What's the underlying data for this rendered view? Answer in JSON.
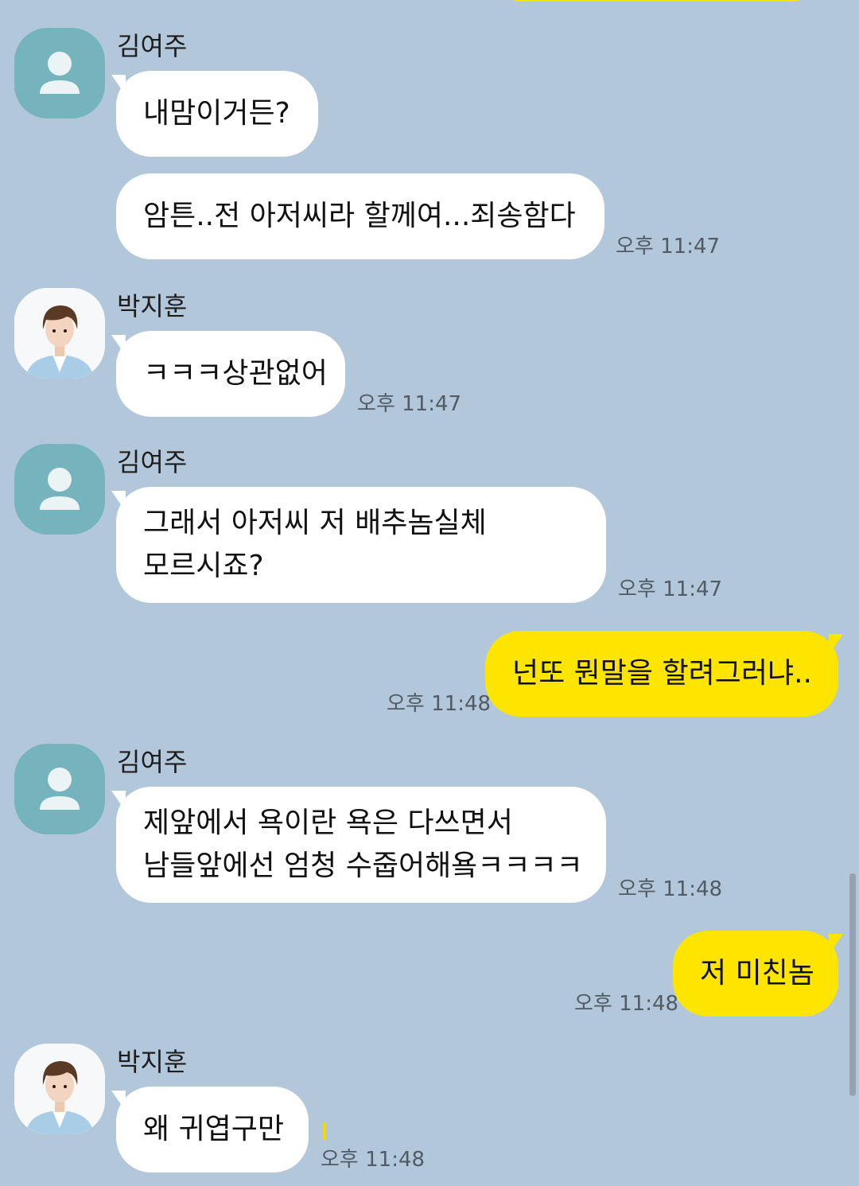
{
  "conversation": {
    "messages": [
      {
        "sender": "김여주",
        "direction": "incoming",
        "text": "내맘이거든?",
        "time": ""
      },
      {
        "sender": "김여주",
        "direction": "incoming",
        "text": "암튼..전 아저씨라 할께여...죄송함다",
        "time": "오후 11:47"
      },
      {
        "sender": "박지훈",
        "direction": "incoming",
        "text": "ㅋㅋㅋ상관없어",
        "time": "오후 11:47"
      },
      {
        "sender": "김여주",
        "direction": "incoming",
        "lines": [
          "그래서 아저씨 저 배추놈실체",
          "모르시죠?"
        ],
        "time": "오후 11:47"
      },
      {
        "sender": "",
        "direction": "outgoing",
        "text": "넌또 뭔말을 할려그러냐..",
        "time": "오후 11:48"
      },
      {
        "sender": "김여주",
        "direction": "incoming",
        "lines": [
          "제앞에서 욕이란 욕은 다쓰면서",
          "남들앞에선 엄청 수줍어해욬ㅋㅋㅋㅋ"
        ],
        "time": "오후 11:48"
      },
      {
        "sender": "",
        "direction": "outgoing",
        "text": "저 미친놈",
        "time": "오후 11:48"
      },
      {
        "sender": "박지훈",
        "direction": "incoming",
        "text": "왜 귀엽구만",
        "time": "오후 11:48"
      }
    ]
  },
  "colors": {
    "background": "#b2c7da",
    "incoming_bubble": "#ffffff",
    "outgoing_bubble": "#fee500",
    "default_avatar": "#75b3bd",
    "timestamp": "#4f5b66"
  },
  "icons": {
    "default_avatar": "person-icon",
    "photo_avatar": "profile-photo"
  }
}
